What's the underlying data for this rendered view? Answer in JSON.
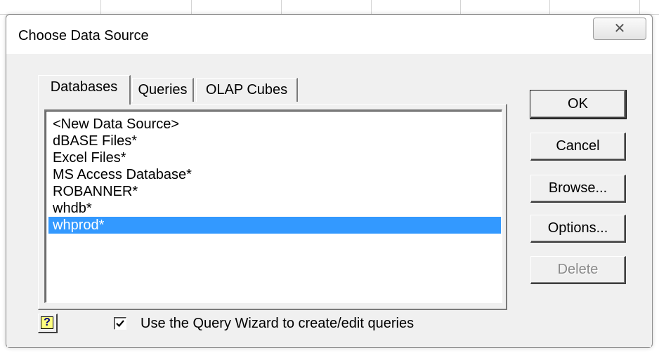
{
  "dialog": {
    "title": "Choose Data Source",
    "close_glyph": "✕"
  },
  "tabs": [
    {
      "label": "Databases",
      "active": true
    },
    {
      "label": "Queries",
      "active": false
    },
    {
      "label": "OLAP Cubes",
      "active": false
    }
  ],
  "list": {
    "items": [
      "<New Data Source>",
      "dBASE Files*",
      "Excel Files*",
      "MS Access Database*",
      "ROBANNER*",
      "whdb*",
      "whprod*"
    ],
    "selected_index": 6
  },
  "buttons": {
    "ok": "OK",
    "cancel": "Cancel",
    "browse": "Browse...",
    "options": "Options...",
    "delete": "Delete"
  },
  "help": {
    "glyph": "?"
  },
  "wizard_option": {
    "label": "Use the Query Wizard to create/edit queries",
    "checked": true
  },
  "colors": {
    "selection": "#3399ff",
    "dialog_bg": "#f0f0f0",
    "disabled_text": "#8a8a8a"
  }
}
